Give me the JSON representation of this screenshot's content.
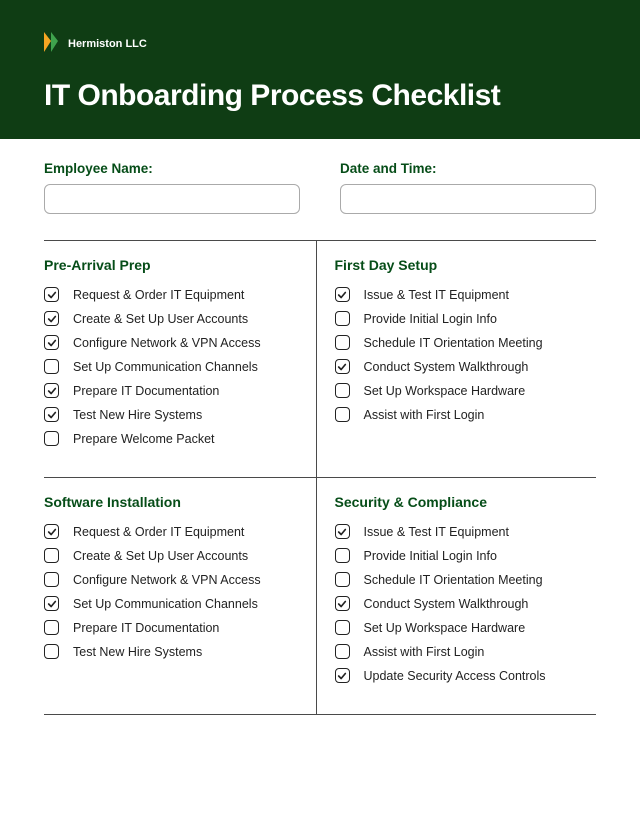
{
  "brand": "Hermiston LLC",
  "title": "IT Onboarding Process Checklist",
  "form": {
    "employee_label": "Employee Name:",
    "employee_value": "",
    "datetime_label": "Date and Time:",
    "datetime_value": ""
  },
  "sections": [
    {
      "title": "Pre-Arrival Prep",
      "items": [
        {
          "label": "Request & Order IT Equipment",
          "checked": true
        },
        {
          "label": "Create & Set Up User Accounts",
          "checked": true
        },
        {
          "label": "Configure Network & VPN Access",
          "checked": true
        },
        {
          "label": "Set Up Communication Channels",
          "checked": false
        },
        {
          "label": "Prepare IT Documentation",
          "checked": true
        },
        {
          "label": "Test New Hire Systems",
          "checked": true
        },
        {
          "label": "Prepare Welcome Packet",
          "checked": false
        }
      ]
    },
    {
      "title": "First Day Setup",
      "items": [
        {
          "label": "Issue & Test IT Equipment",
          "checked": true
        },
        {
          "label": "Provide Initial Login Info",
          "checked": false
        },
        {
          "label": "Schedule IT Orientation Meeting",
          "checked": false
        },
        {
          "label": "Conduct System Walkthrough",
          "checked": true
        },
        {
          "label": "Set Up Workspace Hardware",
          "checked": false
        },
        {
          "label": "Assist with First Login",
          "checked": false
        }
      ]
    },
    {
      "title": "Software Installation",
      "items": [
        {
          "label": "Request & Order IT Equipment",
          "checked": true
        },
        {
          "label": "Create & Set Up User Accounts",
          "checked": false
        },
        {
          "label": "Configure Network & VPN Access",
          "checked": false
        },
        {
          "label": "Set Up Communication Channels",
          "checked": true
        },
        {
          "label": "Prepare IT Documentation",
          "checked": false
        },
        {
          "label": "Test New Hire Systems",
          "checked": false
        }
      ]
    },
    {
      "title": "Security & Compliance",
      "items": [
        {
          "label": "Issue & Test IT Equipment",
          "checked": true
        },
        {
          "label": "Provide Initial Login Info",
          "checked": false
        },
        {
          "label": "Schedule IT Orientation Meeting",
          "checked": false
        },
        {
          "label": "Conduct System Walkthrough",
          "checked": true
        },
        {
          "label": "Set Up Workspace Hardware",
          "checked": false
        },
        {
          "label": "Assist with First Login",
          "checked": false
        },
        {
          "label": "Update Security Access Controls",
          "checked": true
        }
      ]
    }
  ]
}
